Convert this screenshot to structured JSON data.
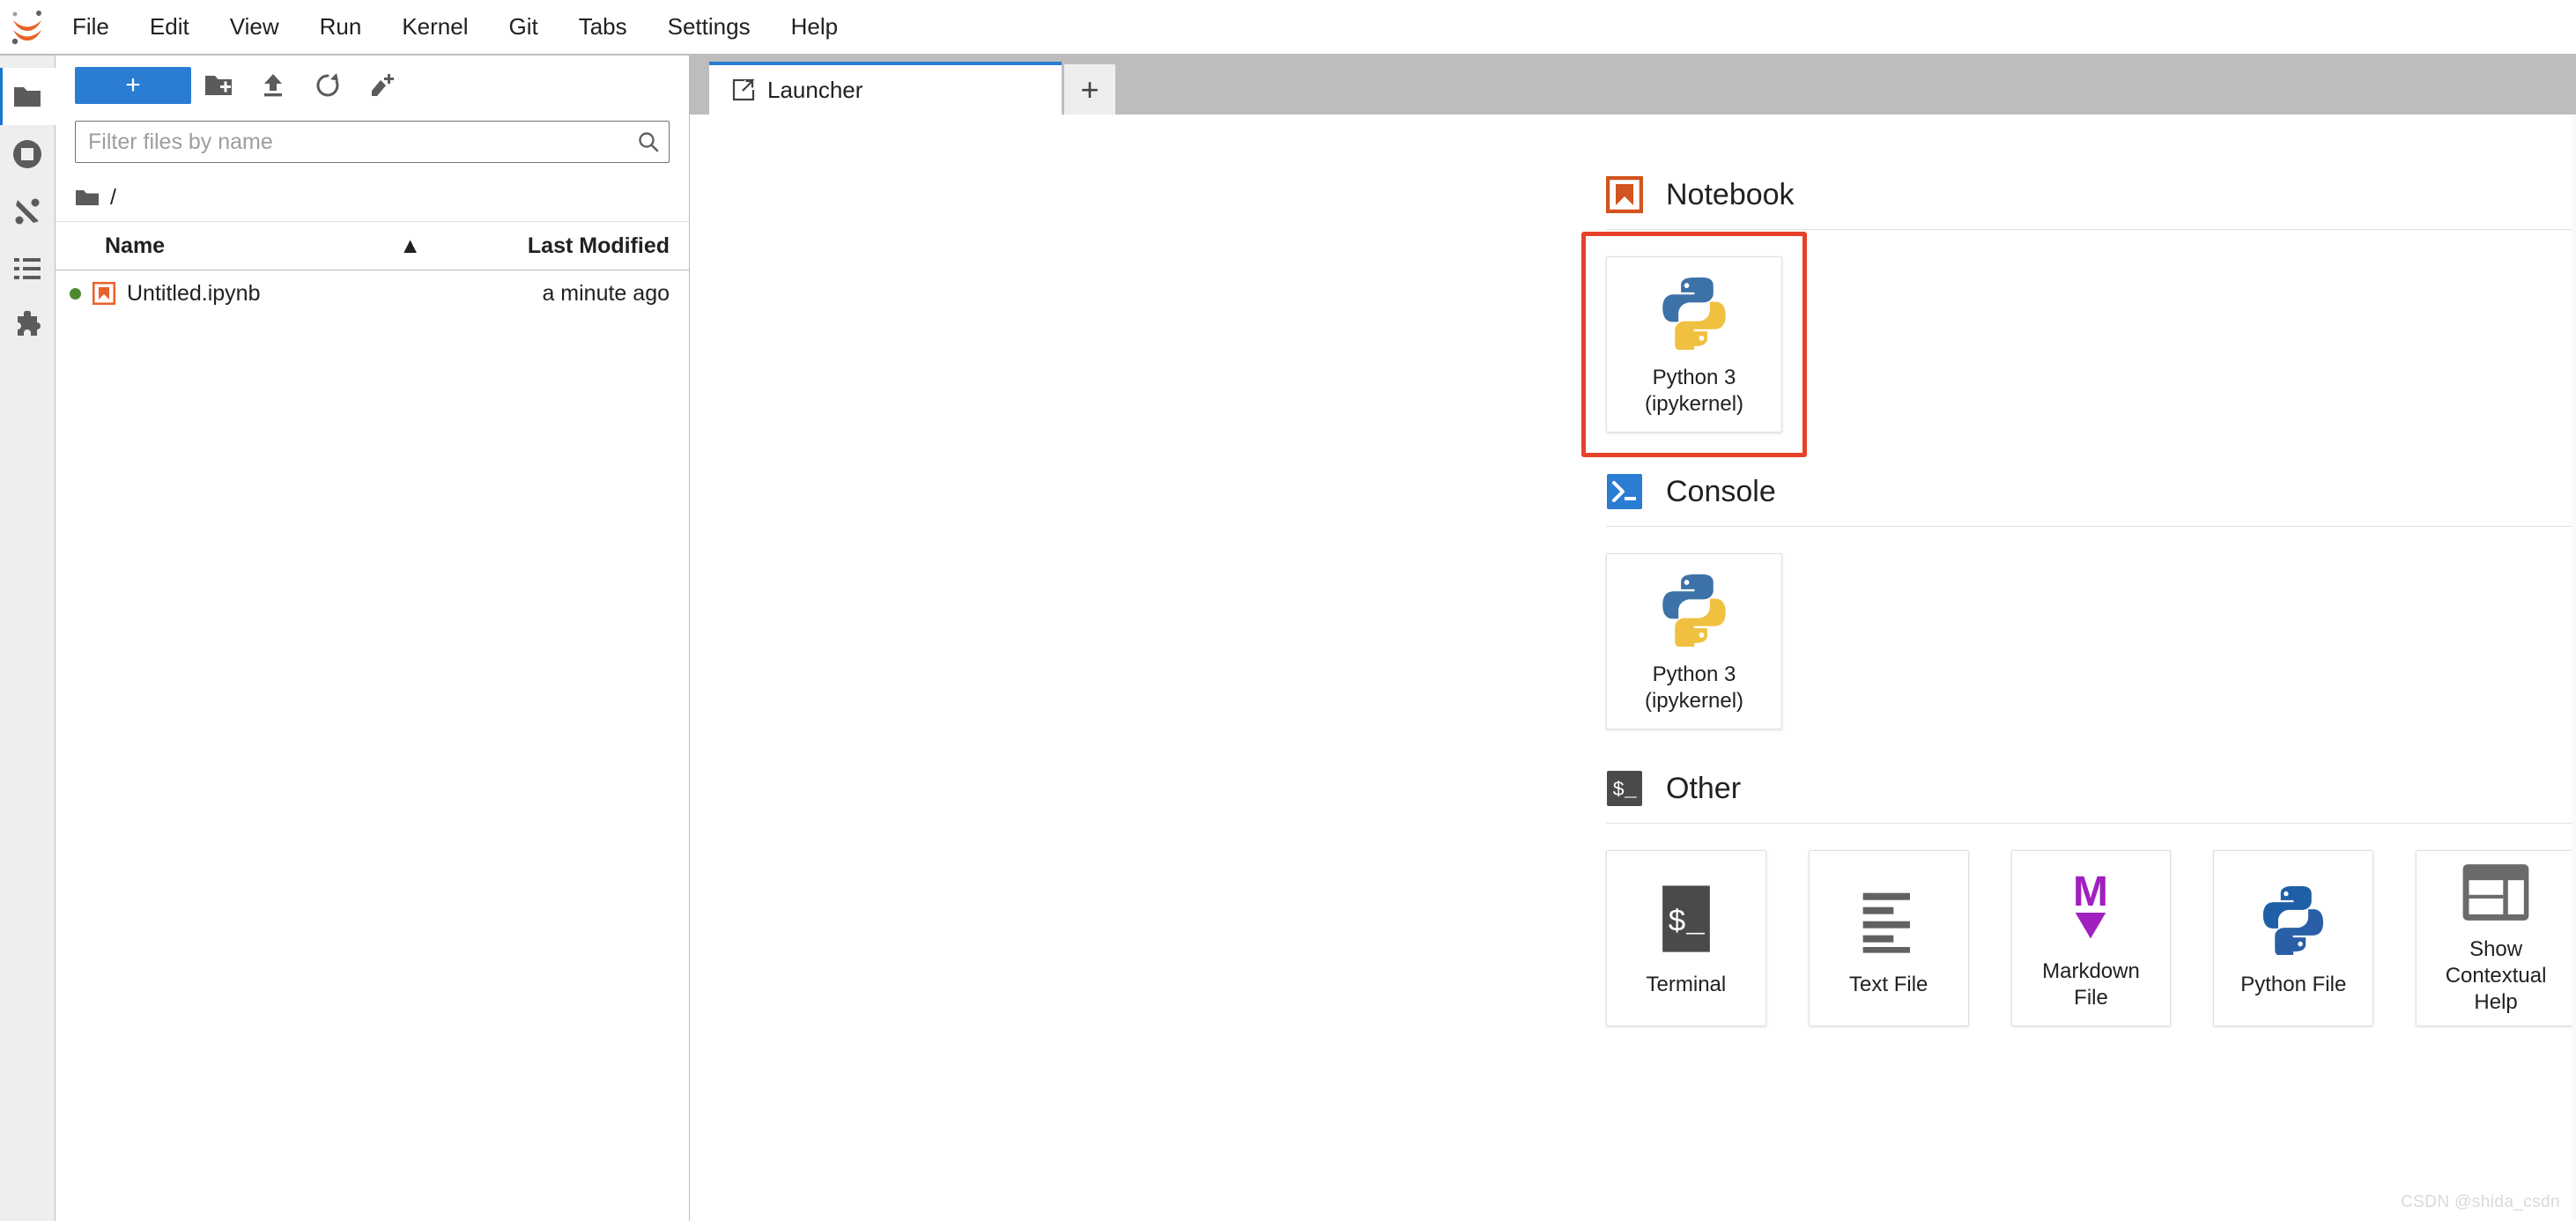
{
  "app": {
    "logo_name": "jupyter-logo",
    "accent_blue": "#2b7cd3",
    "accent_orange": "#e8622a",
    "highlight_red": "#e8412a",
    "watermark": "CSDN @shida_csdn"
  },
  "menubar": {
    "items": [
      {
        "label": "File",
        "name": "menu-file"
      },
      {
        "label": "Edit",
        "name": "menu-edit"
      },
      {
        "label": "View",
        "name": "menu-view"
      },
      {
        "label": "Run",
        "name": "menu-run"
      },
      {
        "label": "Kernel",
        "name": "menu-kernel"
      },
      {
        "label": "Git",
        "name": "menu-git"
      },
      {
        "label": "Tabs",
        "name": "menu-tabs"
      },
      {
        "label": "Settings",
        "name": "menu-settings"
      },
      {
        "label": "Help",
        "name": "menu-help"
      }
    ]
  },
  "sidebar_rail": {
    "items": [
      {
        "icon": "folder-icon",
        "name": "sidebar-item-file-browser",
        "active": true
      },
      {
        "icon": "stop-circle-icon",
        "name": "sidebar-item-running-terminals",
        "active": false
      },
      {
        "icon": "git-branch-icon",
        "name": "sidebar-item-git",
        "active": false
      },
      {
        "icon": "list-icon",
        "name": "sidebar-item-table-of-contents",
        "active": false
      },
      {
        "icon": "puzzle-icon",
        "name": "sidebar-item-extension-manager",
        "active": false
      }
    ]
  },
  "file_browser": {
    "toolbar": {
      "new_label": "+",
      "new_folder_icon": "new-folder-icon",
      "upload_icon": "upload-icon",
      "refresh_icon": "refresh-icon",
      "git_clone_icon": "new-checkout-icon"
    },
    "filter": {
      "placeholder": "Filter files by name",
      "value": "",
      "search_icon": "search-icon"
    },
    "breadcrumb": {
      "root_icon": "folder-icon",
      "path": "/"
    },
    "columns": {
      "name": "Name",
      "last_modified": "Last Modified",
      "sort_caret": "▲"
    },
    "rows": [
      {
        "name": "Untitled.ipynb",
        "last_modified": "a minute ago",
        "icon": "notebook-icon",
        "running": true
      }
    ]
  },
  "tabbar": {
    "tabs": [
      {
        "label": "Launcher",
        "icon": "launcher-icon",
        "active": true
      }
    ],
    "add_tab_label": "+"
  },
  "launcher": {
    "sections": [
      {
        "title": "Notebook",
        "icon": "notebook-icon",
        "name": "launcher-section-notebook",
        "cards": [
          {
            "label": "Python 3\n(ipykernel)",
            "label_line1": "Python 3",
            "label_line2": "(ipykernel)",
            "icon": "python-icon",
            "name": "launcher-card-notebook-python3",
            "highlighted": true
          }
        ]
      },
      {
        "title": "Console",
        "icon": "console-icon",
        "name": "launcher-section-console",
        "cards": [
          {
            "label": "Python 3\n(ipykernel)",
            "label_line1": "Python 3",
            "label_line2": "(ipykernel)",
            "icon": "python-icon",
            "name": "launcher-card-console-python3",
            "highlighted": false
          }
        ]
      },
      {
        "title": "Other",
        "icon": "terminal-icon",
        "name": "launcher-section-other",
        "cards": [
          {
            "label_line1": "Terminal",
            "label_line2": "",
            "icon": "terminal-icon",
            "name": "launcher-card-terminal",
            "highlighted": false
          },
          {
            "label_line1": "Text File",
            "label_line2": "",
            "icon": "text-file-icon",
            "name": "launcher-card-text-file",
            "highlighted": false
          },
          {
            "label_line1": "Markdown File",
            "label_line2": "",
            "icon": "markdown-icon",
            "name": "launcher-card-markdown-file",
            "highlighted": false
          },
          {
            "label_line1": "Python File",
            "label_line2": "",
            "icon": "python-icon",
            "name": "launcher-card-python-file",
            "highlighted": false
          },
          {
            "label_line1": "Show",
            "label_line2": "Contextual Help",
            "icon": "contextual-help-icon",
            "name": "launcher-card-contextual-help",
            "highlighted": false
          }
        ]
      }
    ]
  }
}
